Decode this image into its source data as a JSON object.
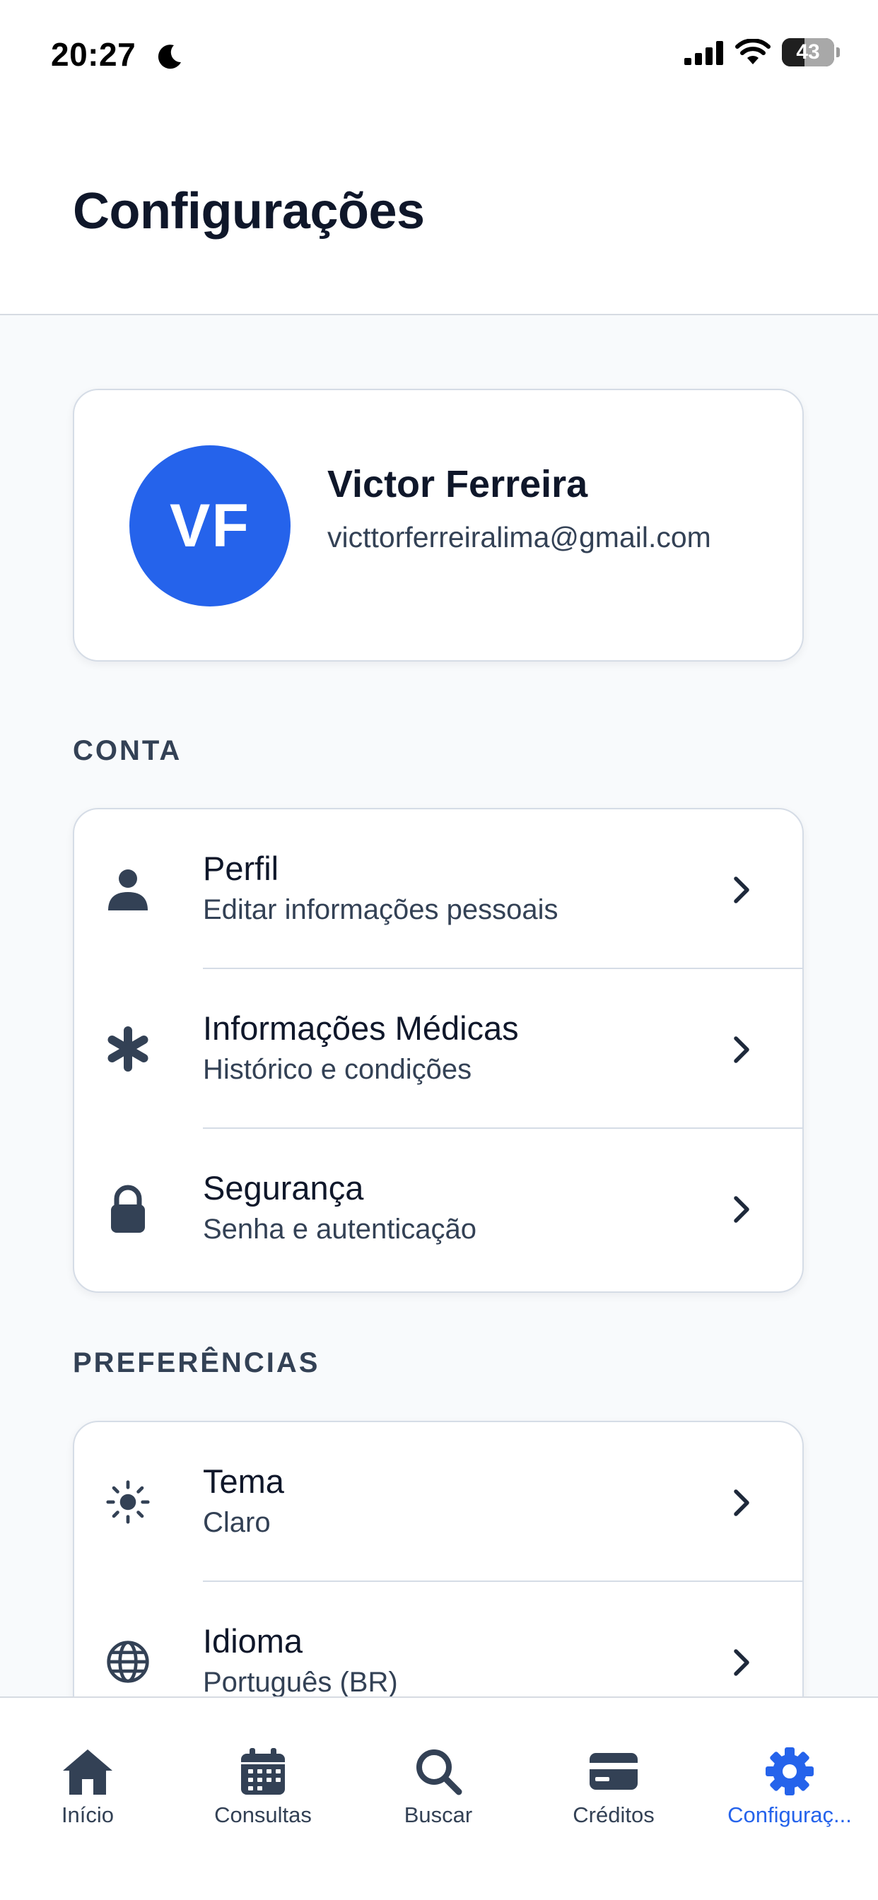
{
  "status_bar": {
    "time": "20:27",
    "battery": "43",
    "battery_level": 0.43
  },
  "header": {
    "title": "Configurações"
  },
  "profile": {
    "initials": "VF",
    "name": "Victor Ferreira",
    "email": "victtorferreiralima@gmail.com",
    "avatar_color": "#2563eb"
  },
  "sections": {
    "account": {
      "label": "CONTA",
      "items": [
        {
          "title": "Perfil",
          "subtitle": "Editar informações pessoais",
          "icon": "person-icon"
        },
        {
          "title": "Informações Médicas",
          "subtitle": "Histórico e condições",
          "icon": "asterisk-icon"
        },
        {
          "title": "Segurança",
          "subtitle": "Senha e autenticação",
          "icon": "lock-icon"
        }
      ]
    },
    "preferences": {
      "label": "PREFERÊNCIAS",
      "items": [
        {
          "title": "Tema",
          "subtitle": "Claro",
          "icon": "sun-icon"
        },
        {
          "title": "Idioma",
          "subtitle": "Português (BR)",
          "icon": "globe-icon"
        }
      ]
    }
  },
  "tab_bar": {
    "active_color": "#2563eb",
    "tabs": [
      {
        "label": "Início",
        "icon": "home-icon"
      },
      {
        "label": "Consultas",
        "icon": "calendar-icon"
      },
      {
        "label": "Buscar",
        "icon": "search-icon"
      },
      {
        "label": "Créditos",
        "icon": "card-icon"
      },
      {
        "label": "Configuraç...",
        "icon": "gear-icon",
        "active": true
      }
    ]
  }
}
